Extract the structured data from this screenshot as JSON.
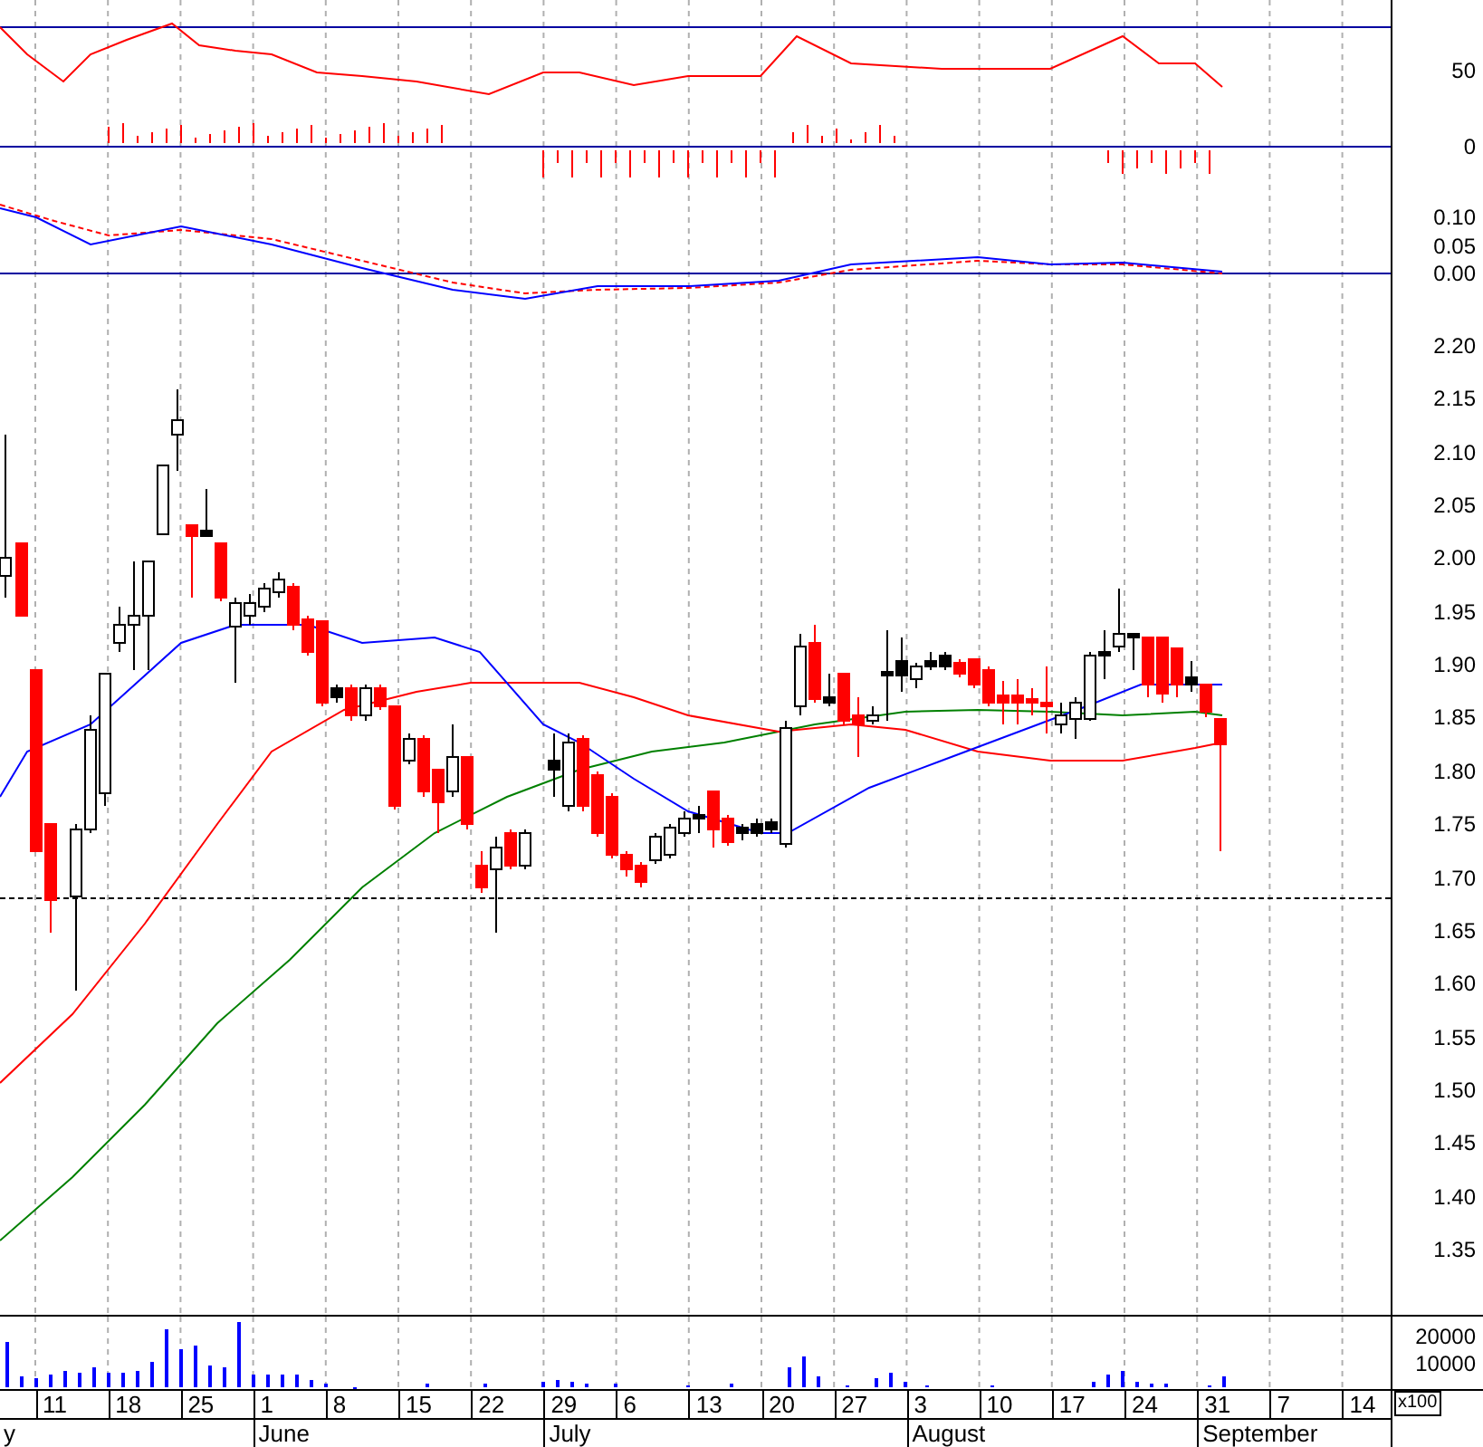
{
  "oscillator_axis": {
    "labels": [
      "50",
      "0"
    ]
  },
  "macd_axis": {
    "labels": [
      "0.10",
      "0.05",
      "0.00"
    ]
  },
  "price_axis": {
    "labels": [
      "2.20",
      "2.15",
      "2.10",
      "2.05",
      "2.00",
      "1.95",
      "1.90",
      "1.85",
      "1.80",
      "1.75",
      "1.70",
      "1.65",
      "1.60",
      "1.55",
      "1.50",
      "1.45",
      "1.40",
      "1.35"
    ]
  },
  "volume_axis": {
    "labels": [
      "20000",
      "10000"
    ],
    "unit": "x100"
  },
  "date_axis": {
    "days": [
      "11",
      "18",
      "25",
      "1",
      "8",
      "15",
      "22",
      "29",
      "6",
      "13",
      "20",
      "27",
      "3",
      "10",
      "17",
      "24",
      "31",
      "7",
      "14"
    ],
    "months": [
      "y",
      "June",
      "July",
      "August",
      "September"
    ]
  }
}
